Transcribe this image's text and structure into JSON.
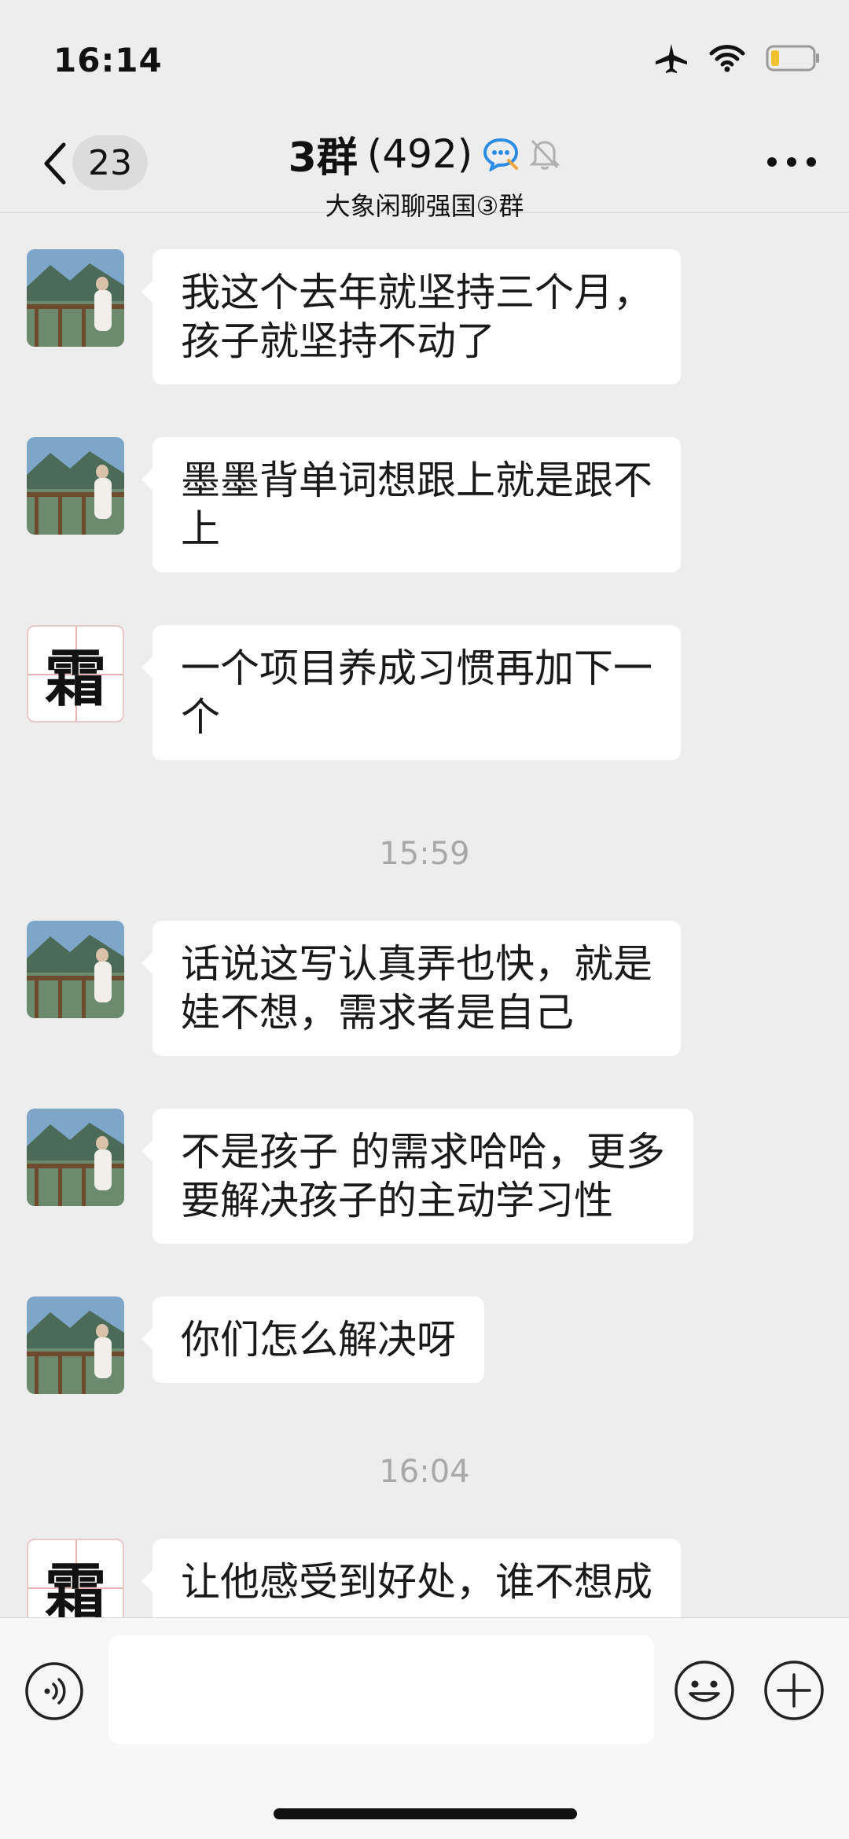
{
  "status_bar": {
    "time": "16:14",
    "battery_color": "#f2c12e"
  },
  "header": {
    "unread_count": "23",
    "title": "3群",
    "member_count": "(492)",
    "subtitle": "大象闲聊强国③群",
    "icons": [
      "back-chevron-icon",
      "chat-bubble-icon",
      "mute-bell-icon",
      "more-icon"
    ]
  },
  "messages": [
    {
      "avatar": "landscape",
      "lines": [
        "我这个去年就坚持三个月，",
        "孩子就坚持不动了"
      ]
    },
    {
      "avatar": "landscape",
      "lines": [
        "墨墨背单词想跟上就是跟不",
        "上"
      ]
    },
    {
      "avatar": "frost",
      "lines": [
        "一个项目养成习惯再加下一",
        "个"
      ]
    },
    {
      "type": "time",
      "text": "15:59"
    },
    {
      "avatar": "landscape",
      "lines": [
        "话说这写认真弄也快，就是",
        "娃不想，需求者是自己"
      ]
    },
    {
      "avatar": "landscape",
      "lines": [
        "不是孩子 的需求哈哈，更多",
        "要解决孩子的主动学习性"
      ]
    },
    {
      "avatar": "landscape",
      "lines": [
        "你们怎么解决呀"
      ]
    },
    {
      "type": "time",
      "text": "16:04"
    },
    {
      "avatar": "frost",
      "lines": [
        "让他感受到好处，谁不想成"
      ]
    }
  ],
  "frost_avatar_char": "霜",
  "input": {
    "placeholder": "",
    "value": ""
  }
}
